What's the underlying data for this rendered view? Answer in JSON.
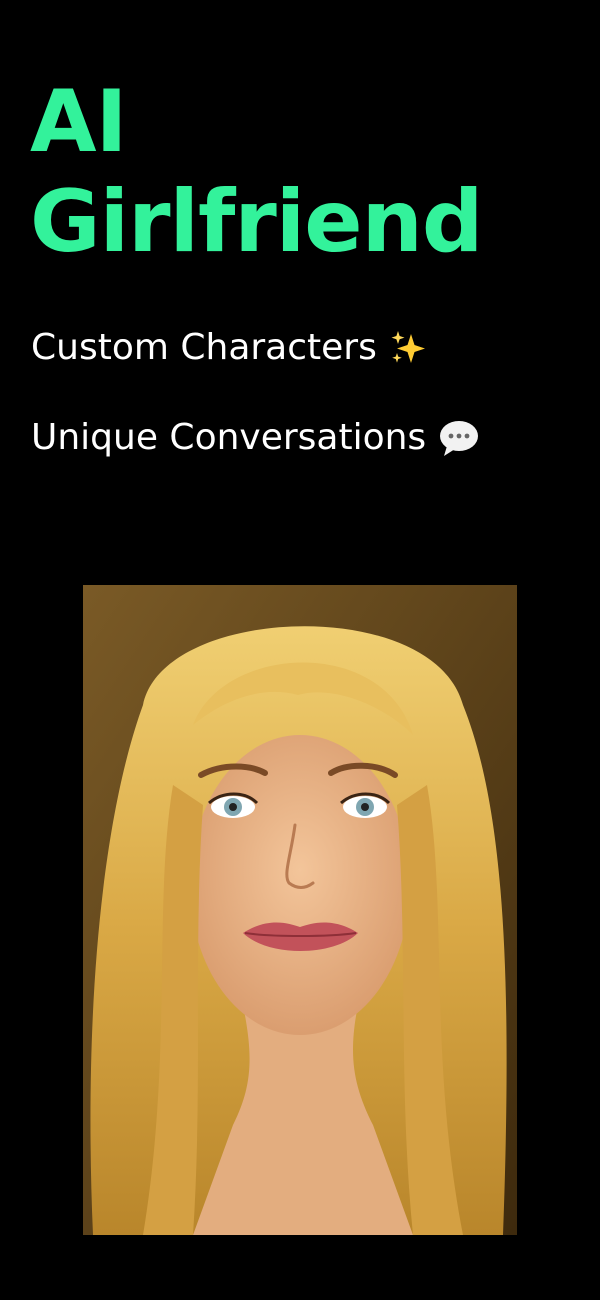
{
  "headline": {
    "line1": "AI",
    "line2": "Girlfriend"
  },
  "features": [
    {
      "label": "Custom Characters",
      "icon": "sparkles-icon"
    },
    {
      "label": "Unique Conversations",
      "icon": "speech-bubble-icon"
    }
  ],
  "colors": {
    "background": "#000000",
    "accent": "#33F29B",
    "text": "#FFFFFF"
  },
  "portrait": {
    "icon": "portrait-photo"
  }
}
